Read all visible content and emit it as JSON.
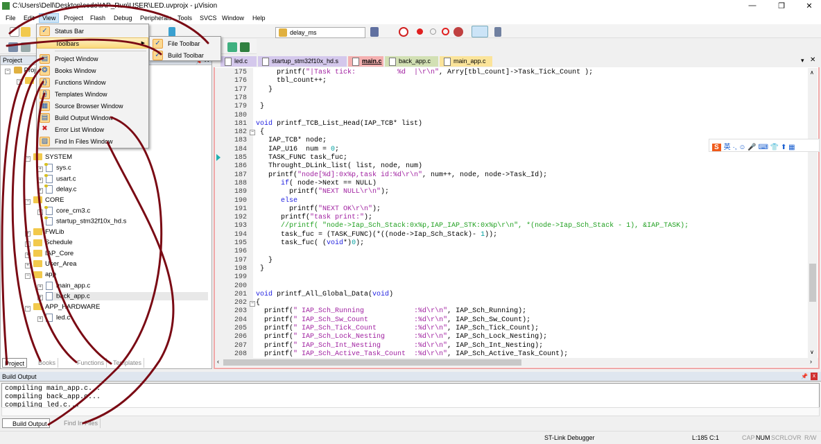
{
  "window": {
    "title": "C:\\Users\\Dell\\Desktop\\code\\IAP_Run\\USER\\LED.uvprojx - µVision",
    "minimize": "—",
    "maximize": "❐",
    "close": "✕"
  },
  "menubar": [
    "File",
    "Edit",
    "View",
    "Project",
    "Flash",
    "Debug",
    "Peripherals",
    "Tools",
    "SVCS",
    "Window",
    "Help"
  ],
  "toolbar": {
    "find_combo_value": "delay_ms"
  },
  "view_menu": {
    "items": [
      {
        "label": "Status Bar",
        "checked": true
      },
      {
        "label": "Toolbars",
        "submenu": true
      },
      {
        "label": "Project Window"
      },
      {
        "label": "Books Window"
      },
      {
        "label": "Functions Window"
      },
      {
        "label": "Templates Window"
      },
      {
        "label": "Source Browser Window"
      },
      {
        "label": "Build Output Window"
      },
      {
        "label": "Error List Window"
      },
      {
        "label": "Find In Files Window"
      }
    ],
    "toolbars_submenu": [
      {
        "label": "File Toolbar",
        "checked": true
      },
      {
        "label": "Build Toolbar",
        "checked": true
      }
    ]
  },
  "project_panel": {
    "title": "Project",
    "root_label": "Proje",
    "target_label": "T",
    "tree": [
      {
        "label": "SYSTEM",
        "type": "folder",
        "open": true,
        "level": 1
      },
      {
        "label": "sys.c",
        "type": "file",
        "level": 2,
        "key": true
      },
      {
        "label": "usart.c",
        "type": "file",
        "level": 2,
        "key": true
      },
      {
        "label": "delay.c",
        "type": "file",
        "level": 2,
        "key": true
      },
      {
        "label": "CORE",
        "type": "folder",
        "open": true,
        "level": 1
      },
      {
        "label": "core_cm3.c",
        "type": "file",
        "level": 2,
        "key": true
      },
      {
        "label": "startup_stm32f10x_hd.s",
        "type": "file",
        "level": 2,
        "key": true,
        "leaf": true
      },
      {
        "label": "FWLib",
        "type": "folder",
        "level": 1
      },
      {
        "label": "Schedule",
        "type": "folder",
        "level": 1
      },
      {
        "label": "IAP_Core",
        "type": "folder",
        "level": 1
      },
      {
        "label": "User_Area",
        "type": "folder",
        "level": 1
      },
      {
        "label": "app",
        "type": "folder",
        "open": true,
        "level": 1
      },
      {
        "label": "main_app.c",
        "type": "file",
        "level": 2
      },
      {
        "label": "back_app.c",
        "type": "file",
        "level": 2,
        "selected": true
      },
      {
        "label": "APP_HARDWARE",
        "type": "folder",
        "open": true,
        "level": 1
      },
      {
        "label": "led.c",
        "type": "file",
        "level": 2
      }
    ],
    "tabs": [
      "Project",
      "Books",
      "Functions",
      "Templates"
    ]
  },
  "editor": {
    "tabs": [
      {
        "label": "led.c",
        "color": "#d4c8ec"
      },
      {
        "label": "startup_stm32f10x_hd.s",
        "color": "#d4c8ec"
      },
      {
        "label": "main.c",
        "color": "#f4b0b0",
        "active": true
      },
      {
        "label": "back_app.c",
        "color": "#d2e0b4"
      },
      {
        "label": "main_app.c",
        "color": "#fbe49a"
      }
    ],
    "lines": [
      {
        "n": "175",
        "segs": [
          [
            "     printf(",
            "p"
          ],
          [
            "\"|Task tick:          %d  |\\r\\n\"",
            "s"
          ],
          [
            ", Arry[tbl_count]->Task_Tick_Count );",
            "p"
          ]
        ]
      },
      {
        "n": "176",
        "segs": [
          [
            "     tbl_count++;",
            "p"
          ]
        ]
      },
      {
        "n": "177",
        "segs": [
          [
            "   }",
            "p"
          ]
        ]
      },
      {
        "n": "178",
        "segs": []
      },
      {
        "n": "179",
        "segs": [
          [
            " }",
            "p"
          ]
        ]
      },
      {
        "n": "180",
        "segs": []
      },
      {
        "n": "181",
        "segs": [
          [
            "void",
            "k"
          ],
          [
            " printf_TCB_List_Head(IAP_TCB* list)",
            "p"
          ]
        ]
      },
      {
        "n": "182",
        "segs": [
          [
            " {",
            "p"
          ]
        ]
      },
      {
        "n": "183",
        "segs": [
          [
            "   IAP_TCB* node;",
            "p"
          ]
        ]
      },
      {
        "n": "184",
        "segs": [
          [
            "   IAP_U16  num = ",
            "p"
          ],
          [
            "0",
            "n"
          ],
          [
            ";",
            "p"
          ]
        ]
      },
      {
        "n": "185",
        "segs": [
          [
            "   TASK_FUNC task_fuc;",
            "p"
          ]
        ]
      },
      {
        "n": "186",
        "segs": [
          [
            "   Throught_DLink_list( list, node, num)",
            "p"
          ]
        ]
      },
      {
        "n": "187",
        "segs": [
          [
            "   printf(",
            "p"
          ],
          [
            "\"node[%d]:0x%p,task id:%d\\r\\n\"",
            "s"
          ],
          [
            ", num++, node, node->Task_Id);",
            "p"
          ]
        ]
      },
      {
        "n": "188",
        "segs": [
          [
            "      ",
            "p"
          ],
          [
            "if",
            "k"
          ],
          [
            "( node->Next == NULL)",
            "p"
          ]
        ]
      },
      {
        "n": "189",
        "segs": [
          [
            "        printf(",
            "p"
          ],
          [
            "\"NEXT NULL\\r\\n\"",
            "s"
          ],
          [
            ");",
            "p"
          ]
        ]
      },
      {
        "n": "190",
        "segs": [
          [
            "      ",
            "p"
          ],
          [
            "else",
            "k"
          ]
        ]
      },
      {
        "n": "191",
        "segs": [
          [
            "        printf(",
            "p"
          ],
          [
            "\"NEXT OK\\r\\n\"",
            "s"
          ],
          [
            ");",
            "p"
          ]
        ]
      },
      {
        "n": "192",
        "segs": [
          [
            "      printf(",
            "p"
          ],
          [
            "\"task print:\"",
            "s"
          ],
          [
            ");",
            "p"
          ]
        ]
      },
      {
        "n": "193",
        "segs": [
          [
            "      ",
            "p"
          ],
          [
            "//printf( \"node->Iap_Sch_Stack:0x%p,IAP_IAP_STK:0x%p\\r\\n\", *(node->Iap_Sch_Stack - 1), &IAP_TASK);",
            "c"
          ]
        ]
      },
      {
        "n": "194",
        "segs": [
          [
            "      task_fuc = (TASK_FUNC)(*((node->Iap_Sch_Stack)- ",
            "p"
          ],
          [
            "1",
            "n"
          ],
          [
            "));",
            "p"
          ]
        ]
      },
      {
        "n": "195",
        "segs": [
          [
            "      task_fuc( (",
            "p"
          ],
          [
            "void",
            "k"
          ],
          [
            "*)",
            "p"
          ],
          [
            "0",
            "n"
          ],
          [
            ");",
            "p"
          ]
        ]
      },
      {
        "n": "196",
        "segs": []
      },
      {
        "n": "197",
        "segs": [
          [
            "   }",
            "p"
          ]
        ]
      },
      {
        "n": "198",
        "segs": [
          [
            " }",
            "p"
          ]
        ]
      },
      {
        "n": "199",
        "segs": []
      },
      {
        "n": "200",
        "segs": []
      },
      {
        "n": "201",
        "segs": [
          [
            "void",
            "k"
          ],
          [
            " printf_All_Global_Data(",
            "p"
          ],
          [
            "void",
            "k"
          ],
          [
            ")",
            "p"
          ]
        ]
      },
      {
        "n": "202",
        "segs": [
          [
            "{",
            "p"
          ]
        ]
      },
      {
        "n": "203",
        "segs": [
          [
            "  printf(",
            "p"
          ],
          [
            "\" IAP_Sch_Running",
            "s"
          ],
          [
            "            :%d\\r\\n\"",
            "s"
          ],
          [
            ", IAP_Sch_Running);",
            "p"
          ]
        ]
      },
      {
        "n": "204",
        "segs": [
          [
            "  printf(",
            "p"
          ],
          [
            "\" IAP_Sch_Sw_Count",
            "s"
          ],
          [
            "           :%d\\r\\n\"",
            "s"
          ],
          [
            ", IAP_Sch_Sw_Count);",
            "p"
          ]
        ]
      },
      {
        "n": "205",
        "segs": [
          [
            "  printf(",
            "p"
          ],
          [
            "\" IAP_Sch_Tick_Count",
            "s"
          ],
          [
            "         :%d\\r\\n\"",
            "s"
          ],
          [
            ", IAP_Sch_Tick_Count);",
            "p"
          ]
        ]
      },
      {
        "n": "206",
        "segs": [
          [
            "  printf(",
            "p"
          ],
          [
            "\" IAP_Sch_Lock_Nesting",
            "s"
          ],
          [
            "       :%d\\r\\n\"",
            "s"
          ],
          [
            ", IAP_Sch_Lock_Nesting);",
            "p"
          ]
        ]
      },
      {
        "n": "207",
        "segs": [
          [
            "  printf(",
            "p"
          ],
          [
            "\" IAP_Sch_Int_Nesting",
            "s"
          ],
          [
            "        :%d\\r\\n\"",
            "s"
          ],
          [
            ", IAP_Sch_Int_Nesting);",
            "p"
          ]
        ]
      },
      {
        "n": "208",
        "segs": [
          [
            "  printf(",
            "p"
          ],
          [
            "\" IAP_Sch_Active_Task_Count",
            "s"
          ],
          [
            "  :%d\\r\\n\"",
            "s"
          ],
          [
            ", IAP_Sch_Active_Task_Count);",
            "p"
          ]
        ]
      }
    ]
  },
  "build_output": {
    "title": "Build Output",
    "lines": [
      "compiling main_app.c...",
      "compiling back_app.c...",
      "compiling led.c..."
    ],
    "tabs": [
      "Build Output",
      "Find In Files"
    ]
  },
  "ime": {
    "logo": "S",
    "text": "英 ·, ☺ 🎤 ⌨ 👕 ⬆ ▦"
  },
  "status": {
    "debugger": "ST-Link Debugger",
    "position": "L:185 C:1",
    "indicators": [
      "CAP",
      "NUM",
      "SCRL",
      "OVR",
      "R/W"
    ]
  },
  "colors": {
    "annotation": "#7a0a14",
    "menu_highlight": "#fbd97a",
    "active_tab": "#f4b0b0"
  }
}
